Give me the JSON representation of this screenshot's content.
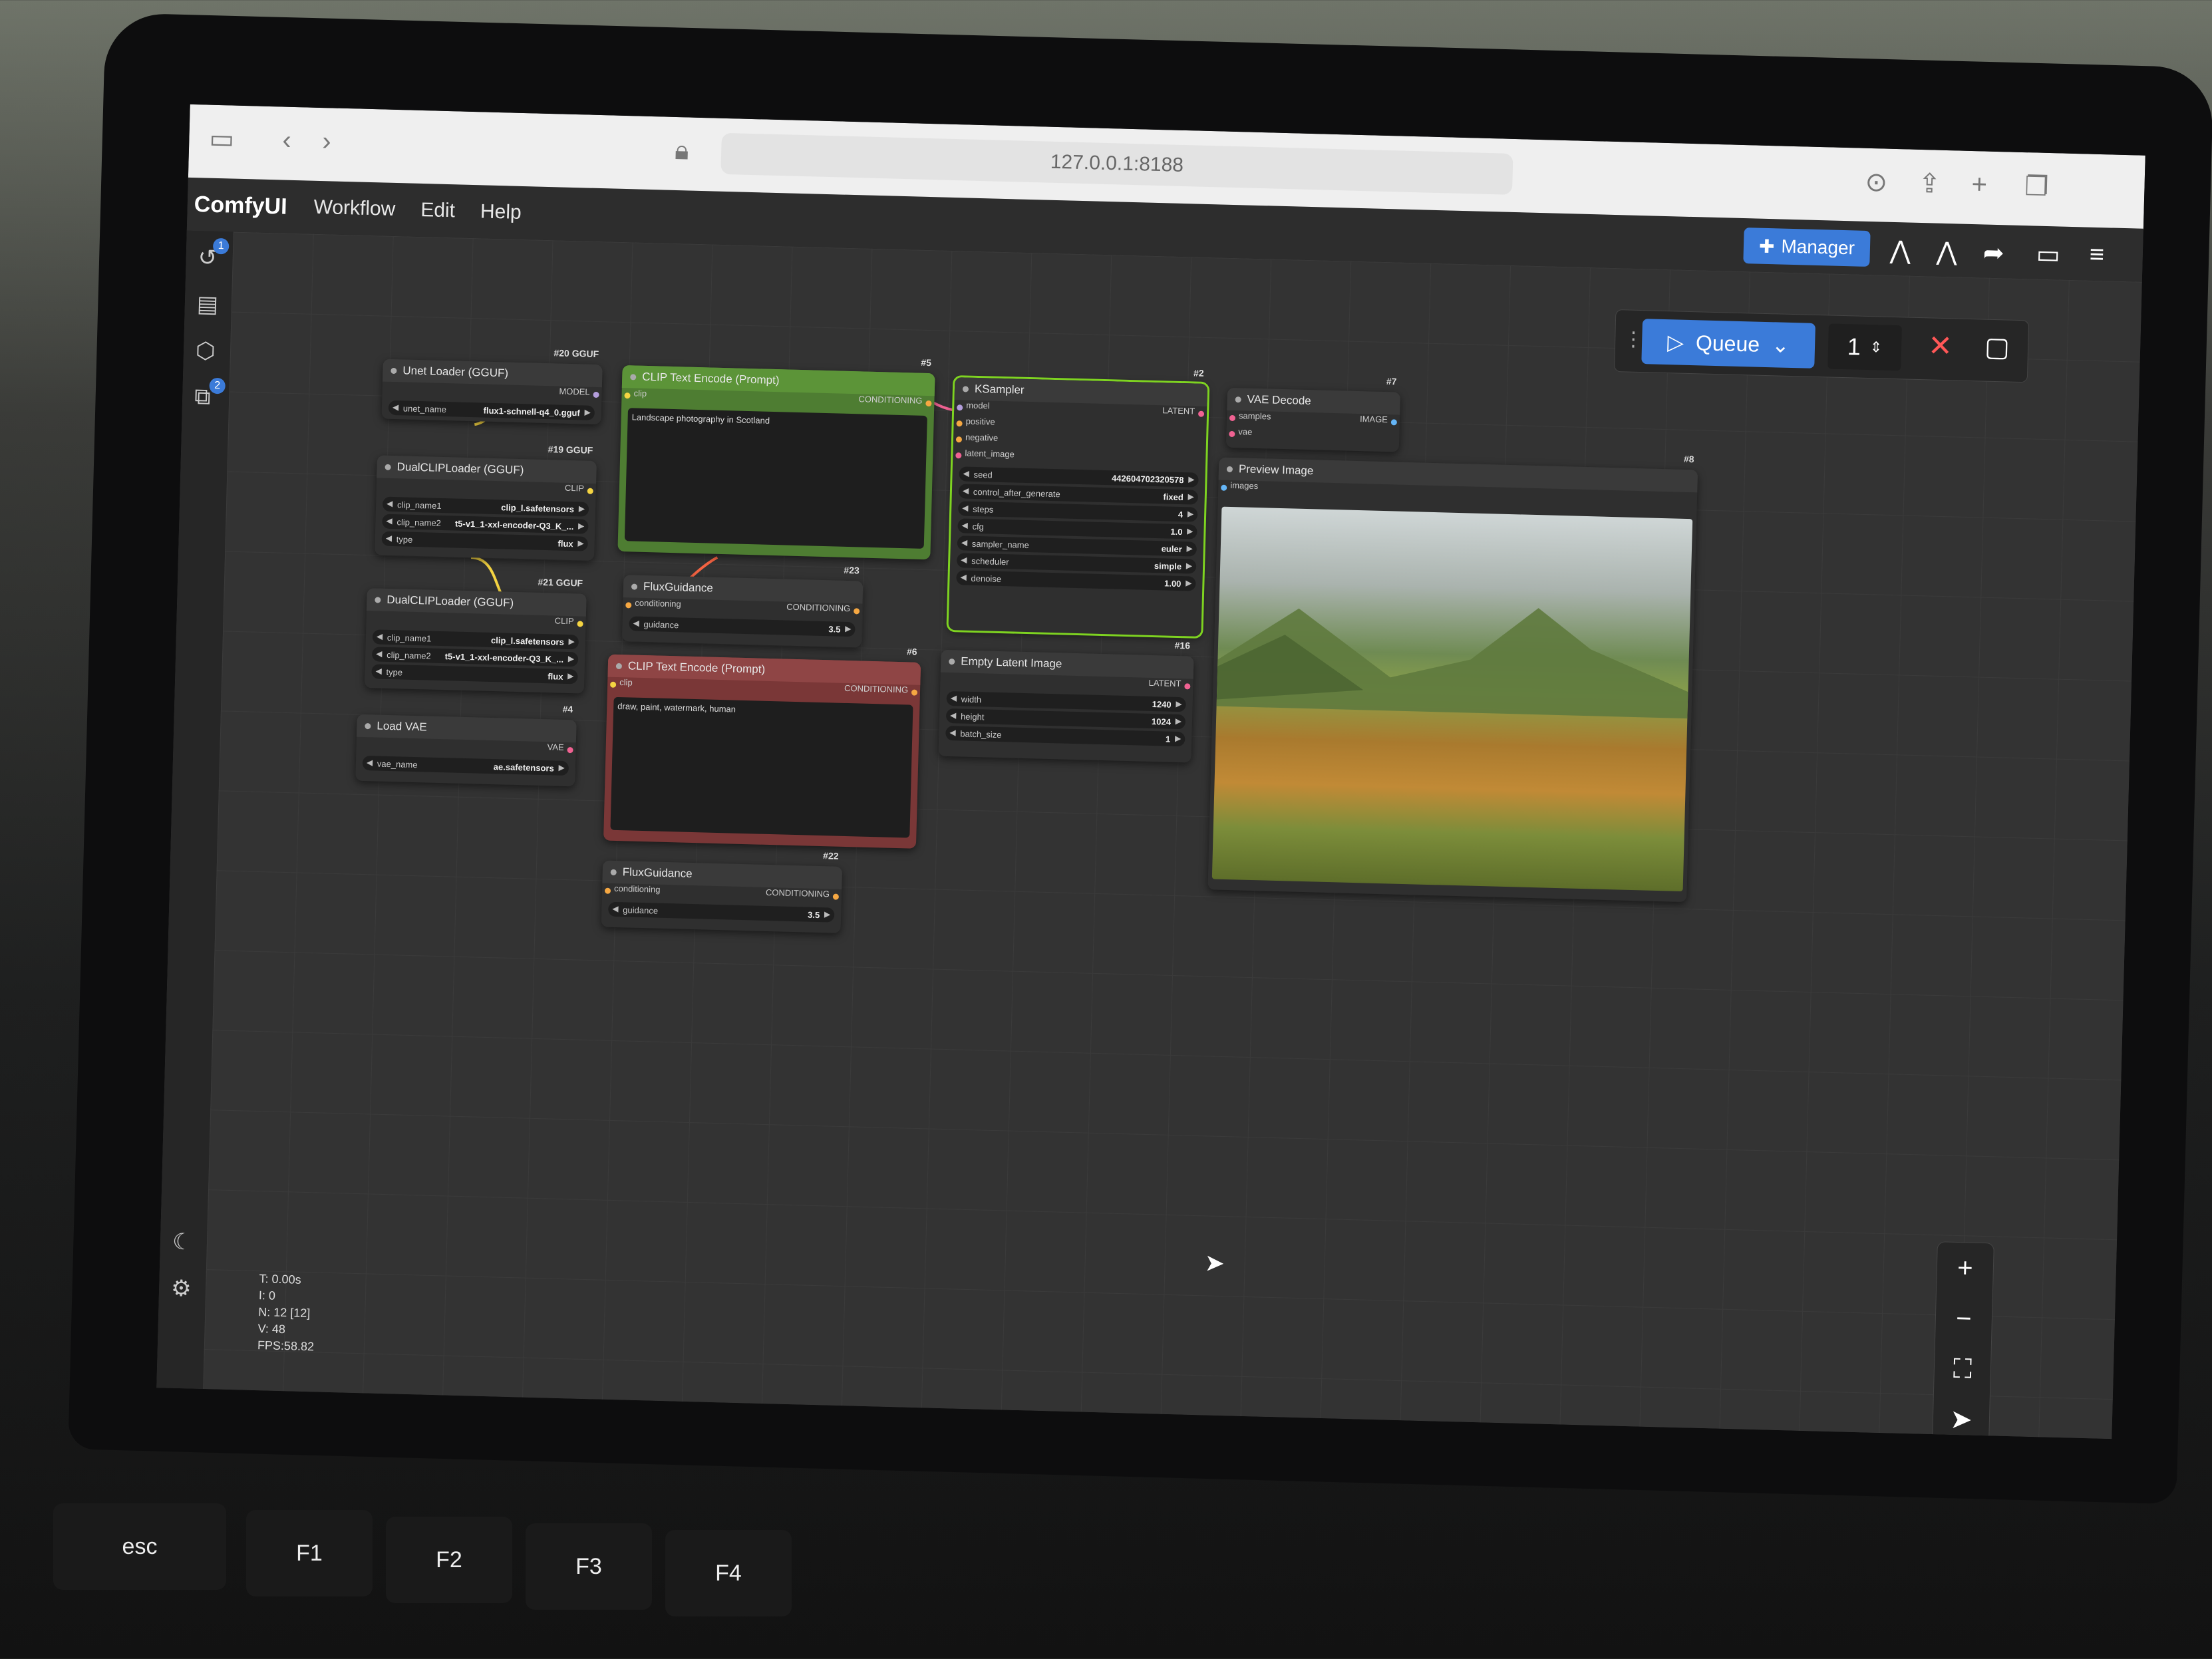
{
  "browser": {
    "url": "127.0.0.1:8188"
  },
  "menubar": {
    "brand": "ComfyUI",
    "items": [
      "Workflow",
      "Edit",
      "Help"
    ],
    "manager_label": "Manager"
  },
  "sidebar": {
    "history_badge": "1",
    "workflow_badge": "2"
  },
  "queue": {
    "label": "Queue",
    "count": "1"
  },
  "nodes": {
    "unet": {
      "id": "#20 GGUF",
      "title": "Unet Loader (GGUF)",
      "out": "MODEL",
      "w_label": "unet_name",
      "w_value": "flux1-schnell-q4_0.gguf"
    },
    "dual1": {
      "id": "#19 GGUF",
      "title": "DualCLIPLoader (GGUF)",
      "out": "CLIP",
      "widgets": [
        [
          "clip_name1",
          "clip_l.safetensors"
        ],
        [
          "clip_name2",
          "t5-v1_1-xxl-encoder-Q3_K_..."
        ],
        [
          "type",
          "flux"
        ]
      ]
    },
    "dual2": {
      "id": "#21 GGUF",
      "title": "DualCLIPLoader (GGUF)",
      "out": "CLIP",
      "widgets": [
        [
          "clip_name1",
          "clip_l.safetensors"
        ],
        [
          "clip_name2",
          "t5-v1_1-xxl-encoder-Q3_K_..."
        ],
        [
          "type",
          "flux"
        ]
      ]
    },
    "vae_load": {
      "id": "#4",
      "title": "Load VAE",
      "out": "VAE",
      "w_label": "vae_name",
      "w_value": "ae.safetensors"
    },
    "clip_pos": {
      "id": "#5",
      "title": "CLIP Text Encode (Prompt)",
      "in": "clip",
      "out": "CONDITIONING",
      "text": "Landscape photography in Scotland"
    },
    "flux1": {
      "id": "#23",
      "title": "FluxGuidance",
      "in": "conditioning",
      "out": "CONDITIONING",
      "w_label": "guidance",
      "w_value": "3.5"
    },
    "clip_neg": {
      "id": "#6",
      "title": "CLIP Text Encode (Prompt)",
      "in": "clip",
      "out": "CONDITIONING",
      "text": "draw, paint, watermark, human"
    },
    "flux2": {
      "id": "#22",
      "title": "FluxGuidance",
      "in": "conditioning",
      "out": "CONDITIONING",
      "w_label": "guidance",
      "w_value": "3.5"
    },
    "ksampler": {
      "id": "#2",
      "title": "KSampler",
      "out": "LATENT",
      "inputs": [
        "model",
        "positive",
        "negative",
        "latent_image"
      ],
      "widgets": [
        [
          "seed",
          "442604702320578"
        ],
        [
          "control_after_generate",
          "fixed"
        ],
        [
          "steps",
          "4"
        ],
        [
          "cfg",
          "1.0"
        ],
        [
          "sampler_name",
          "euler"
        ],
        [
          "scheduler",
          "simple"
        ],
        [
          "denoise",
          "1.00"
        ]
      ]
    },
    "latent": {
      "id": "#16",
      "title": "Empty Latent Image",
      "out": "LATENT",
      "widgets": [
        [
          "width",
          "1240"
        ],
        [
          "height",
          "1024"
        ],
        [
          "batch_size",
          "1"
        ]
      ]
    },
    "vae_dec": {
      "id": "#7",
      "title": "VAE Decode",
      "inputs": [
        "samples",
        "vae"
      ],
      "out": "IMAGE"
    },
    "preview": {
      "id": "#8",
      "title": "Preview Image",
      "in": "images"
    }
  },
  "stats": {
    "t": "T: 0.00s",
    "i": "I: 0",
    "n": "N: 12 [12]",
    "v": "V: 48",
    "fps": "FPS:58.82"
  },
  "keyboard": {
    "esc": "esc",
    "f1": "F1",
    "f2": "F2",
    "f3": "F3",
    "f4": "F4"
  },
  "colors": {
    "accent": "#3b7bd9",
    "positive_node": "#4e7d32",
    "negative_node": "#7a3737",
    "active_outline": "#7ed321"
  }
}
